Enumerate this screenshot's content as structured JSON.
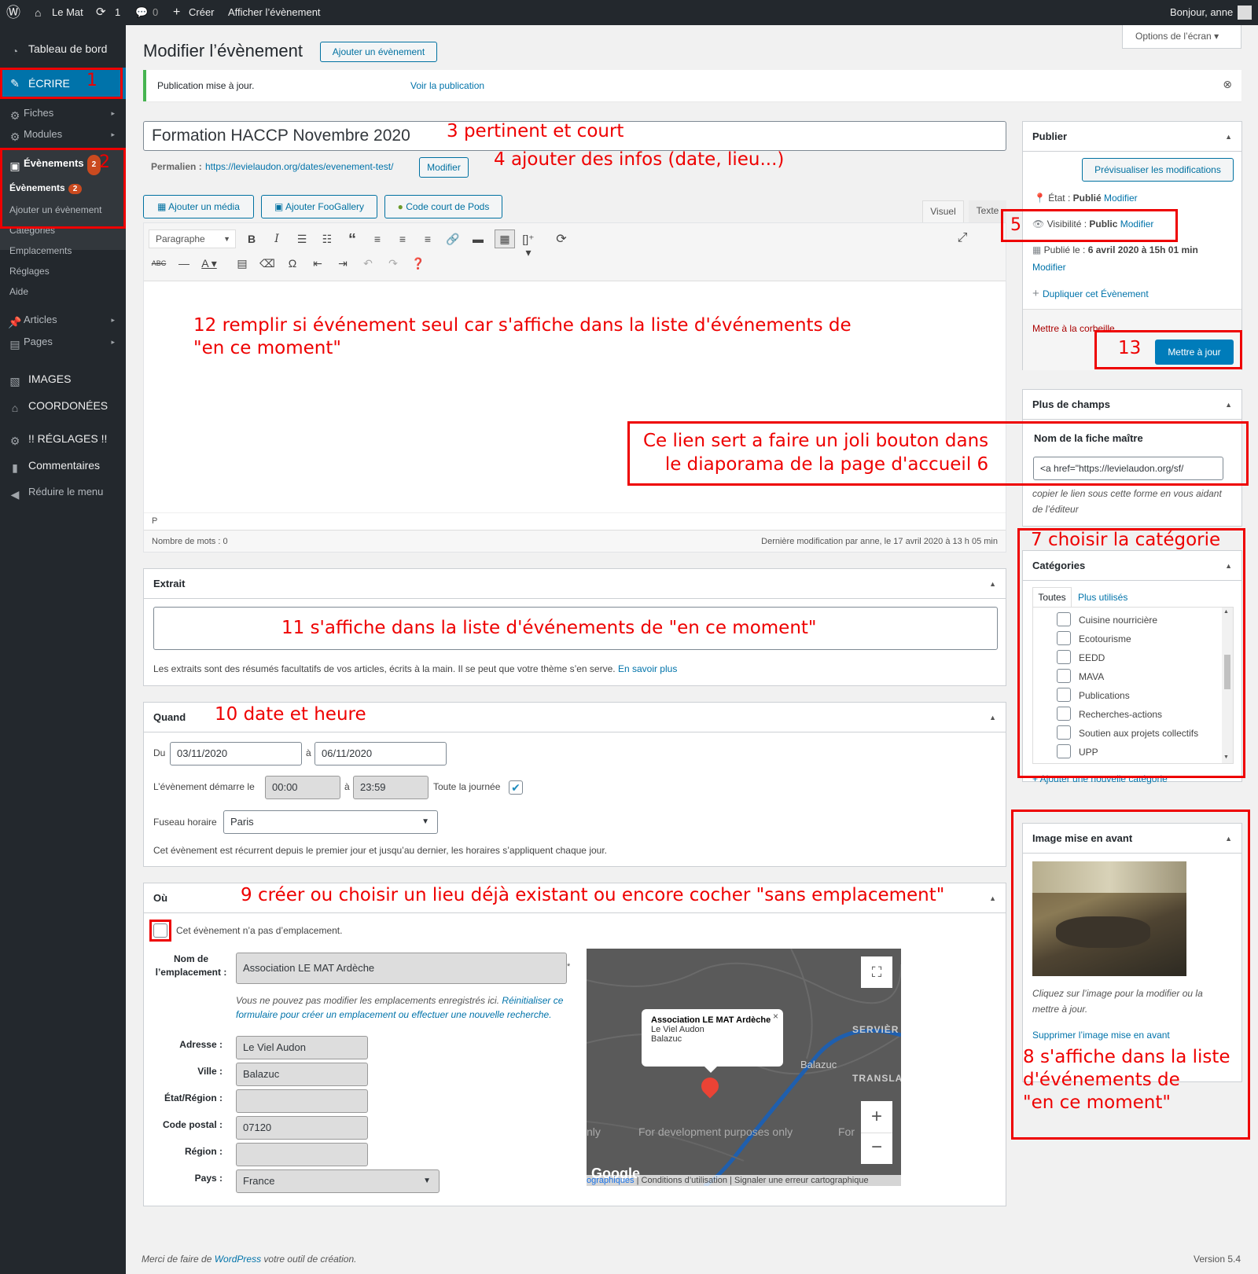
{
  "adminbar": {
    "site": "Le Mat",
    "updates": "1",
    "comments": "0",
    "create": "Créer",
    "view": "Afficher l’évènement",
    "greeting": "Bonjour, anne"
  },
  "sidebar": {
    "dashboard": "Tableau de bord",
    "write": "ÉCRIRE",
    "fiches": "Fiches",
    "modules": "Modules",
    "events": "Évènements",
    "events_count": "2",
    "sub_events": "Évènements",
    "sub_add": "Ajouter un évènement",
    "categories": "Catégories",
    "locations": "Emplacements",
    "settings": "Réglages",
    "help": "Aide",
    "articles": "Articles",
    "pages": "Pages",
    "images": "IMAGES",
    "contacts": "COORDONÉES",
    "reglages": "!! RÉGLAGES !!",
    "comments": "Commentaires",
    "collapse": "Réduire le menu"
  },
  "header": {
    "title": "Modifier l’évènement",
    "add_new": "Ajouter un évènement",
    "screen_options": "Options de l’écran"
  },
  "notice": {
    "text": "Publication mise à jour.",
    "link": "Voir la publication"
  },
  "post": {
    "title": "Formation HACCP Novembre 2020",
    "permalink_label": "Permalien :",
    "permalink_url": "https://levielaudon.org/dates/evenement-test/",
    "permalink_edit": "Modifier"
  },
  "media_buttons": {
    "media": "Ajouter un média",
    "foogallery": "Ajouter FooGallery",
    "pods": "Code court de Pods"
  },
  "editor": {
    "tab_visual": "Visuel",
    "tab_text": "Texte",
    "format": "Paragraphe",
    "path": "P",
    "word_count": "Nombre de mots : 0",
    "last_modified": "Dernière modification par anne, le 17 avril 2020 à 13 h 05 min"
  },
  "excerpt": {
    "title": "Extrait",
    "help": "Les extraits sont des résumés facultatifs de vos articles, écrits à la main. Il se peut que votre thème s’en serve.",
    "help_link": "En savoir plus"
  },
  "when": {
    "title": "Quand",
    "du": "Du",
    "start_date": "03/11/2020",
    "a": "à",
    "end_date": "06/11/2020",
    "starts_label": "L’évènement démarre le",
    "start_time": "00:00",
    "end_time": "23:59",
    "all_day": "Toute la journée",
    "tz_label": "Fuseau horaire",
    "tz_value": "Paris",
    "recurring_note": "Cet évènement est récurrent depuis le premier jour et jusqu’au dernier, les horaires s’appliquent chaque jour."
  },
  "where": {
    "title": "Où",
    "no_location": "Cet évènement n’a pas d’emplacement.",
    "name_label_1": "Nom de",
    "name_label_2": "l’emplacement :",
    "name_value": "Association LE MAT Ardèche",
    "cannot_edit": "Vous ne pouvez pas modifier les emplacements enregistrés ici.",
    "reset_link": "Réinitialiser ce formulaire pour créer un emplacement ou effectuer une nouvelle recherche.",
    "address_label": "Adresse :",
    "address": "Le Viel Audon",
    "city_label": "Ville :",
    "city": "Balazuc",
    "state_label": "État/Région :",
    "state": "",
    "zip_label": "Code postal :",
    "zip": "07120",
    "region_label": "Région :",
    "region": "",
    "country_label": "Pays :",
    "country": "France"
  },
  "map": {
    "popup_title": "Association LE MAT Ardèche",
    "popup_l1": "Le Viel Audon",
    "popup_l2": "Balazuc",
    "town": "Balazuc",
    "label_serv": "SERVIÈR",
    "label_trans": "TRANSLA",
    "dev": "For development purposes only",
    "dev_left": "nly",
    "dev_right": "For",
    "google": "Google",
    "footer_data": "ographiques",
    "footer_terms": "Conditions d’utilisation",
    "footer_report": "Signaler une erreur cartographique"
  },
  "publish": {
    "title": "Publier",
    "preview": "Prévisualiser les modifications",
    "status_label": "État :",
    "status_value": "Publié",
    "status_edit": "Modifier",
    "visibility_label": "Visibilité :",
    "visibility_value": "Public",
    "visibility_edit": "Modifier",
    "published_label": "Publié le :",
    "published_value": "6 avril 2020 à 15h 01 min",
    "published_edit": "Modifier",
    "duplicate": "Dupliquer cet Évènement",
    "trash": "Mettre à la corbeille",
    "update": "Mettre à jour"
  },
  "more_fields": {
    "title": "Plus de champs",
    "field_label": "Nom de la fiche maître",
    "field_value": "<a href=\"https://levielaudon.org/sf/",
    "note": "copier le lien sous cette forme en vous aidant de l’éditeur"
  },
  "categories": {
    "title": "Catégories",
    "tab_all": "Toutes",
    "tab_used": "Plus utilisés",
    "items": [
      "Cuisine nourricière",
      "Ecotourisme",
      "EEDD",
      "MAVA",
      "Publications",
      "Recherches-actions",
      "Soutien aux projets collectifs",
      "UPP"
    ],
    "add": "+ Ajouter une nouvelle catégorie"
  },
  "featured": {
    "title": "Image mise en avant",
    "hint": "Cliquez sur l’image pour la modifier ou la mettre à jour.",
    "remove": "Supprimer l’image mise en avant"
  },
  "footer": {
    "thanks_pre": "Merci de faire de",
    "thanks_link": "WordPress",
    "thanks_post": "votre outil de création.",
    "version": "Version 5.4"
  },
  "annotations": {
    "a1": "1",
    "a2": "2",
    "a3": "3 pertinent et court",
    "a4": "4 ajouter des infos (date, lieu...)",
    "a5": "5",
    "a6_l1": "Ce lien sert a faire un joli bouton dans",
    "a6_l2": "le diaporama de la page d'accueil  6",
    "a7": "7 choisir la catégorie",
    "a8_l1": "8 s'affiche dans la liste",
    "a8_l2": "d'événements de",
    "a8_l3": "\"en ce moment\"",
    "a9": "9 créer ou choisir un lieu déjà existant ou encore cocher \"sans emplacement\"",
    "a10": "10 date et heure",
    "a11": "11 s'affiche dans la liste d'événements de  \"en ce moment\"",
    "a12_l1": "12 remplir si événement seul car s'affiche dans la liste d'événements de",
    "a12_l2": "\"en ce moment\"",
    "a13": "13"
  },
  "colors": {
    "accent": "#0073aa",
    "adminbar": "#23282d",
    "badge": "#ca4a1f",
    "annotation": "#e00000"
  }
}
